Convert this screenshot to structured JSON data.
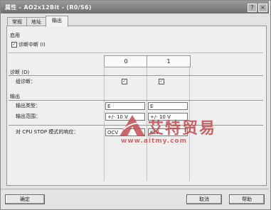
{
  "window": {
    "title": "属性 - AO2x12Bit - (R0/S6)",
    "help_symbol": "?",
    "close_symbol": "×"
  },
  "tabs": [
    {
      "label": "常规",
      "active": false
    },
    {
      "label": "地址",
      "active": false
    },
    {
      "label": "输出",
      "active": true
    }
  ],
  "enable": {
    "group_label": "启用",
    "diag_interrupt_label": "诊断中断 (I)",
    "diag_interrupt_checked": true
  },
  "channels": {
    "col0": "0",
    "col1": "1"
  },
  "diagnostics": {
    "section_label": "诊断 (D)",
    "group_diag_label": "组诊断：",
    "ch0_checked": true,
    "ch1_checked": true
  },
  "output": {
    "section_label": "输出",
    "type_label": "输出类型：",
    "range_label": "输出范围：",
    "type_ch0": "E",
    "type_ch1": "E",
    "range_ch0": "+/- 10 V",
    "range_ch1": "+/- 10 V",
    "cpu_stop_label": "对 CPU STOP 模式的响应：",
    "cpu_stop_ch0": "OCV",
    "cpu_stop_ch1": "KLV"
  },
  "buttons": {
    "ok": "确定",
    "cancel": "取消",
    "help": "帮助"
  },
  "watermark": {
    "brand": "艾特贸易",
    "url": "www.aitmy.com",
    "color": "#c24e51"
  }
}
